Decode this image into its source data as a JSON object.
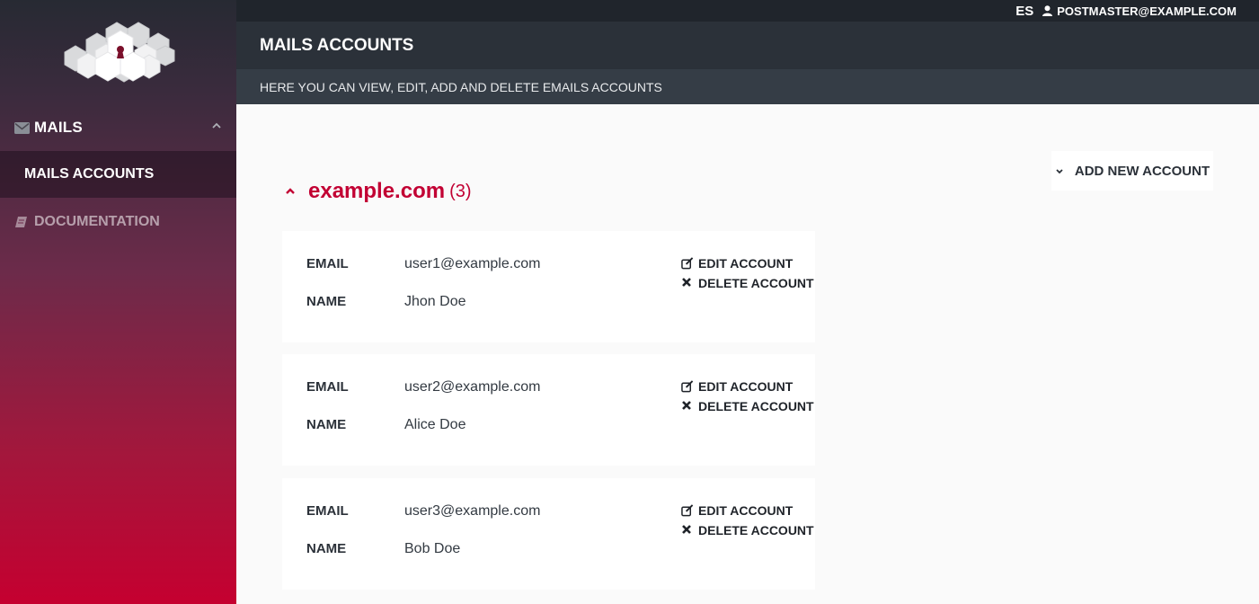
{
  "topbar": {
    "lang": "ES",
    "user": "POSTMASTER@EXAMPLE.COM"
  },
  "sidebar": {
    "mails_label": "MAILS",
    "mails_accounts_label": "MAILS ACCOUNTS",
    "documentation_label": "DOCUMENTATION"
  },
  "header": {
    "title": "MAILS ACCOUNTS",
    "subtitle": "HERE YOU CAN VIEW, EDIT, ADD AND DELETE EMAILS ACCOUNTS"
  },
  "add_button_label": "ADD NEW ACCOUNT",
  "domain": {
    "name": "example.com",
    "count": "(3)"
  },
  "field_labels": {
    "email": "EMAIL",
    "name": "NAME"
  },
  "actions": {
    "edit": "EDIT ACCOUNT",
    "delete": "DELETE ACCOUNT"
  },
  "accounts": [
    {
      "email": "user1@example.com",
      "name": "Jhon Doe"
    },
    {
      "email": "user2@example.com",
      "name": "Alice Doe"
    },
    {
      "email": "user3@example.com",
      "name": "Bob Doe"
    }
  ],
  "colors": {
    "accent": "#c20033",
    "header": "#2b3139",
    "topbar": "#20252c",
    "subheader": "#353d46"
  }
}
